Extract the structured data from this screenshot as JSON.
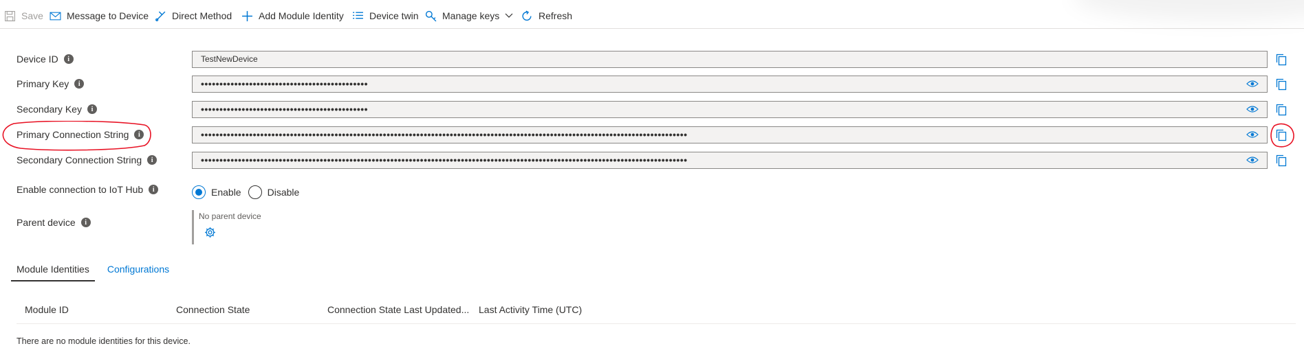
{
  "toolbar": {
    "save": "Save",
    "message": "Message to Device",
    "direct_method": "Direct Method",
    "add_module": "Add Module Identity",
    "device_twin": "Device twin",
    "manage_keys": "Manage keys",
    "refresh": "Refresh"
  },
  "fields": {
    "device_id": {
      "label": "Device ID",
      "value": "TestNewDevice"
    },
    "primary_key": {
      "label": "Primary Key",
      "value": "•••••••••••••••••••••••••••••••••••••••••••••"
    },
    "secondary_key": {
      "label": "Secondary Key",
      "value": "•••••••••••••••••••••••••••••••••••••••••••••"
    },
    "primary_conn": {
      "label": "Primary Connection String",
      "value": "•••••••••••••••••••••••••••••••••••••••••••••••••••••••••••••••••••••••••••••••••••••••••••••••••••••••••••••••••••••••••••••••••••"
    },
    "secondary_conn": {
      "label": "Secondary Connection String",
      "value": "•••••••••••••••••••••••••••••••••••••••••••••••••••••••••••••••••••••••••••••••••••••••••••••••••••••••••••••••••••••••••••••••••••"
    }
  },
  "enable": {
    "label": "Enable connection to IoT Hub",
    "option_enable": "Enable",
    "option_disable": "Disable",
    "selected": "Enable"
  },
  "parent": {
    "label": "Parent device",
    "value": "No parent device"
  },
  "tabs": [
    "Module Identities",
    "Configurations"
  ],
  "table": {
    "columns": [
      "Module ID",
      "Connection State",
      "Connection State Last Updated...",
      "Last Activity Time (UTC)"
    ],
    "empty_message": "There are no module identities for this device."
  },
  "colors": {
    "accent": "#0078d4",
    "annotation": "#e81123"
  }
}
